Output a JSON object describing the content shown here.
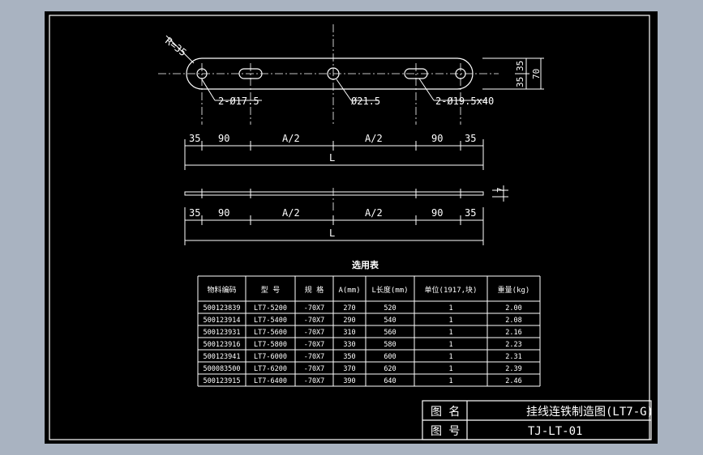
{
  "drawing": {
    "plate_top": {
      "radius_label": "R=35",
      "hole_small_label": "2-Ø17.5",
      "hole_center_label": "Ø21.5",
      "slot_label": "2-Ø19.5x40",
      "height_dim_1": "35",
      "height_dim_2": "35",
      "height_total": "70"
    },
    "dim_row": [
      "35",
      "90",
      "A/2",
      "A/2",
      "90",
      "35"
    ],
    "total_length_label": "L",
    "thickness_label": "7"
  },
  "table": {
    "title": "选用表",
    "headers": [
      "物料编码",
      "型 号",
      "规 格",
      "A(mm)",
      "L长度(mm)",
      "单位(1917,块)",
      "重量(kg)"
    ],
    "rows": [
      [
        "500123839",
        "LT7-5200",
        "-70X7",
        "270",
        "520",
        "1",
        "2.00"
      ],
      [
        "500123914",
        "LT7-5400",
        "-70X7",
        "290",
        "540",
        "1",
        "2.08"
      ],
      [
        "500123931",
        "LT7-5600",
        "-70X7",
        "310",
        "560",
        "1",
        "2.16"
      ],
      [
        "500123916",
        "LT7-5800",
        "-70X7",
        "330",
        "580",
        "1",
        "2.23"
      ],
      [
        "500123941",
        "LT7-6000",
        "-70X7",
        "350",
        "600",
        "1",
        "2.31"
      ],
      [
        "500083500",
        "LT7-6200",
        "-70X7",
        "370",
        "620",
        "1",
        "2.39"
      ],
      [
        "500123915",
        "LT7-6400",
        "-70X7",
        "390",
        "640",
        "1",
        "2.46"
      ]
    ]
  },
  "title_block": {
    "name_label": "图 名",
    "name_value": "挂线连铁制造图(LT7-G)",
    "number_label": "图 号",
    "number_value": "TJ-LT-01"
  },
  "colors": {
    "background": "#a9b3c1",
    "paper": "#000000",
    "line": "#ffffff"
  }
}
